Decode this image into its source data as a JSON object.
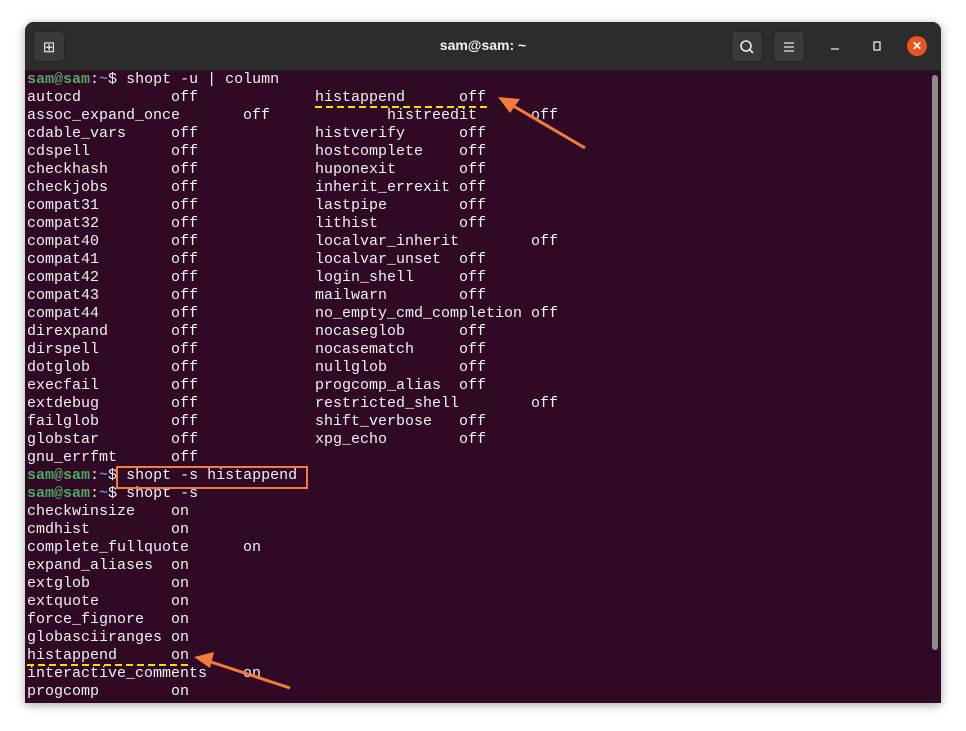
{
  "window": {
    "title": "sam@sam: ~",
    "new_tab_icon": "new-tab-icon",
    "search_icon": "search-icon",
    "menu_icon": "hamburger-menu-icon",
    "minimize_icon": "minimize-icon",
    "maximize_icon": "maximize-icon",
    "close_icon": "close-icon"
  },
  "prompt": {
    "user": "sam@sam",
    "sep": ":",
    "path": "~",
    "dollar": "$"
  },
  "commands": {
    "first": "shopt -u | column",
    "second": "shopt -s histappend",
    "third": "shopt -s"
  },
  "unset_rows": [
    [
      "autocd",
      "off",
      "histappend",
      "off"
    ],
    [
      "assoc_expand_once",
      "off",
      "histreedit",
      "off"
    ],
    [
      "cdable_vars",
      "off",
      "histverify",
      "off"
    ],
    [
      "cdspell",
      "off",
      "hostcomplete",
      "off"
    ],
    [
      "checkhash",
      "off",
      "huponexit",
      "off"
    ],
    [
      "checkjobs",
      "off",
      "inherit_errexit",
      "off"
    ],
    [
      "compat31",
      "off",
      "lastpipe",
      "off"
    ],
    [
      "compat32",
      "off",
      "lithist",
      "off"
    ],
    [
      "compat40",
      "off",
      "localvar_inherit",
      "off"
    ],
    [
      "compat41",
      "off",
      "localvar_unset",
      "off"
    ],
    [
      "compat42",
      "off",
      "login_shell",
      "off"
    ],
    [
      "compat43",
      "off",
      "mailwarn",
      "off"
    ],
    [
      "compat44",
      "off",
      "no_empty_cmd_completion",
      "off"
    ],
    [
      "direxpand",
      "off",
      "nocaseglob",
      "off"
    ],
    [
      "dirspell",
      "off",
      "nocasematch",
      "off"
    ],
    [
      "dotglob",
      "off",
      "nullglob",
      "off"
    ],
    [
      "execfail",
      "off",
      "progcomp_alias",
      "off"
    ],
    [
      "extdebug",
      "off",
      "restricted_shell",
      "off"
    ],
    [
      "failglob",
      "off",
      "shift_verbose",
      "off"
    ],
    [
      "globstar",
      "off",
      "xpg_echo",
      "off"
    ],
    [
      "gnu_errfmt",
      "off"
    ]
  ],
  "set_rows": [
    [
      "checkwinsize",
      "on"
    ],
    [
      "cmdhist",
      "on"
    ],
    [
      "complete_fullquote",
      "on"
    ],
    [
      "expand_aliases",
      "on"
    ],
    [
      "extglob",
      "on"
    ],
    [
      "extquote",
      "on"
    ],
    [
      "force_fignore",
      "on"
    ],
    [
      "globasciiranges",
      "on"
    ],
    [
      "histappend",
      "on"
    ],
    [
      "interactive_comments",
      "on"
    ],
    [
      "progcomp",
      "on"
    ]
  ],
  "colors": {
    "terminal_bg": "#300a24",
    "annotation_orange": "#f47b3c",
    "annotation_yellow": "#f5e000"
  }
}
